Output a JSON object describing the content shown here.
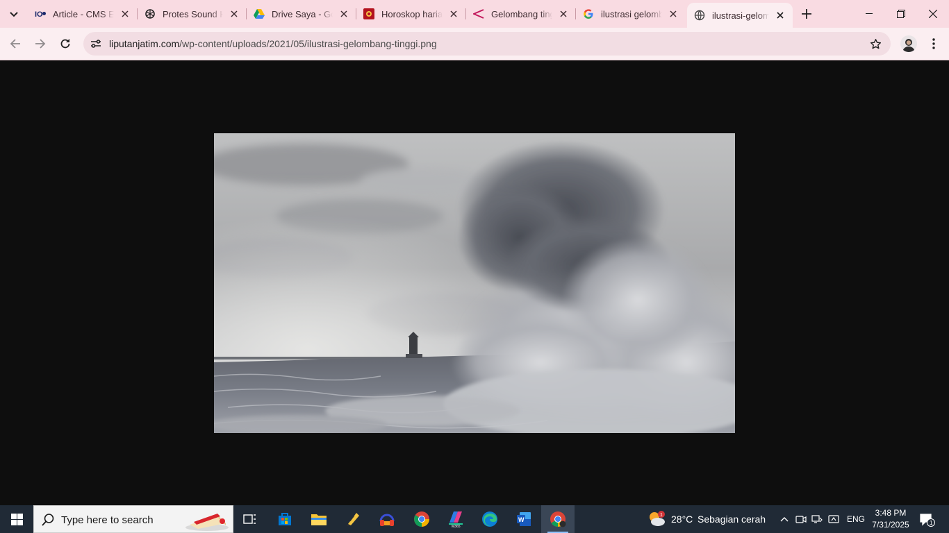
{
  "browser": {
    "tabs": [
      {
        "title": "Article - CMS ED",
        "favicon": "cms-icon",
        "active": false
      },
      {
        "title": "Protes Sound Ho",
        "favicon": "openai-icon",
        "active": false
      },
      {
        "title": "Drive Saya - Goo",
        "favicon": "google-drive-icon",
        "active": false
      },
      {
        "title": "Horoskop harian",
        "favicon": "horoscope-icon",
        "active": false
      },
      {
        "title": "Gelombang ting",
        "favicon": "share-arrow-icon",
        "active": false
      },
      {
        "title": "ilustrasi gelomb",
        "favicon": "google-icon",
        "active": false
      },
      {
        "title": "ilustrasi-gelomb",
        "favicon": "globe-icon",
        "active": true
      }
    ],
    "address": {
      "domain": "liputanjatim.com",
      "path": "/wp-content/uploads/2021/05/ilustrasi-gelombang-tinggi.png"
    }
  },
  "taskbar": {
    "search_placeholder": "Type here to search",
    "apps": [
      "task-view",
      "microsoft-store",
      "file-explorer",
      "pen-app",
      "headset-app",
      "chrome",
      "microsoft-365",
      "edge",
      "word",
      "chrome-profile"
    ],
    "weather": {
      "temp": "28°C",
      "condition": "Sebagian cerah",
      "badge": "1"
    },
    "language": "ENG",
    "time": "3:48 PM",
    "date": "7/31/2025",
    "notification_count": "1"
  },
  "colors": {
    "tabstrip": "#f9dbe2",
    "toolbar": "#fbeef1",
    "viewport": "#0e0e0e",
    "taskbar": "#202a36"
  }
}
